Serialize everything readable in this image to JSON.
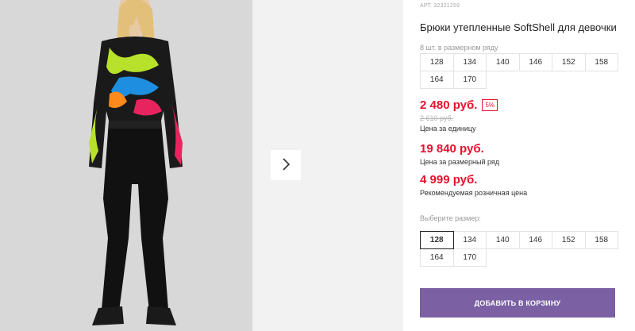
{
  "gallery": {
    "next_icon": "chevron-right-icon"
  },
  "product": {
    "sku": "АРТ. 32321259",
    "title": "Брюки утепленные SoftShell для девочки"
  },
  "pack": {
    "label": "8 шт. в размерном ряду",
    "sizes": [
      "128",
      "134",
      "140",
      "146",
      "152",
      "158",
      "164",
      "170"
    ]
  },
  "pricing": {
    "unit_price": "2 480 руб.",
    "discount": "5%",
    "old_price": "2 610 руб.",
    "unit_caption": "Цена за единицу",
    "pack_price": "19 840 руб.",
    "pack_caption": "Цена за размерный ряд",
    "retail_price": "4 999 руб.",
    "retail_caption": "Рекомендуемая розничная цена"
  },
  "size_select": {
    "label": "Выберите размер:",
    "sizes": [
      "128",
      "134",
      "140",
      "146",
      "152",
      "158",
      "164",
      "170"
    ],
    "selected": "128"
  },
  "cart": {
    "button_label": "ДОБАВИТЬ В КОРЗИНУ"
  },
  "colors": {
    "accent": "#7b60a3",
    "price": "#e8112d"
  }
}
